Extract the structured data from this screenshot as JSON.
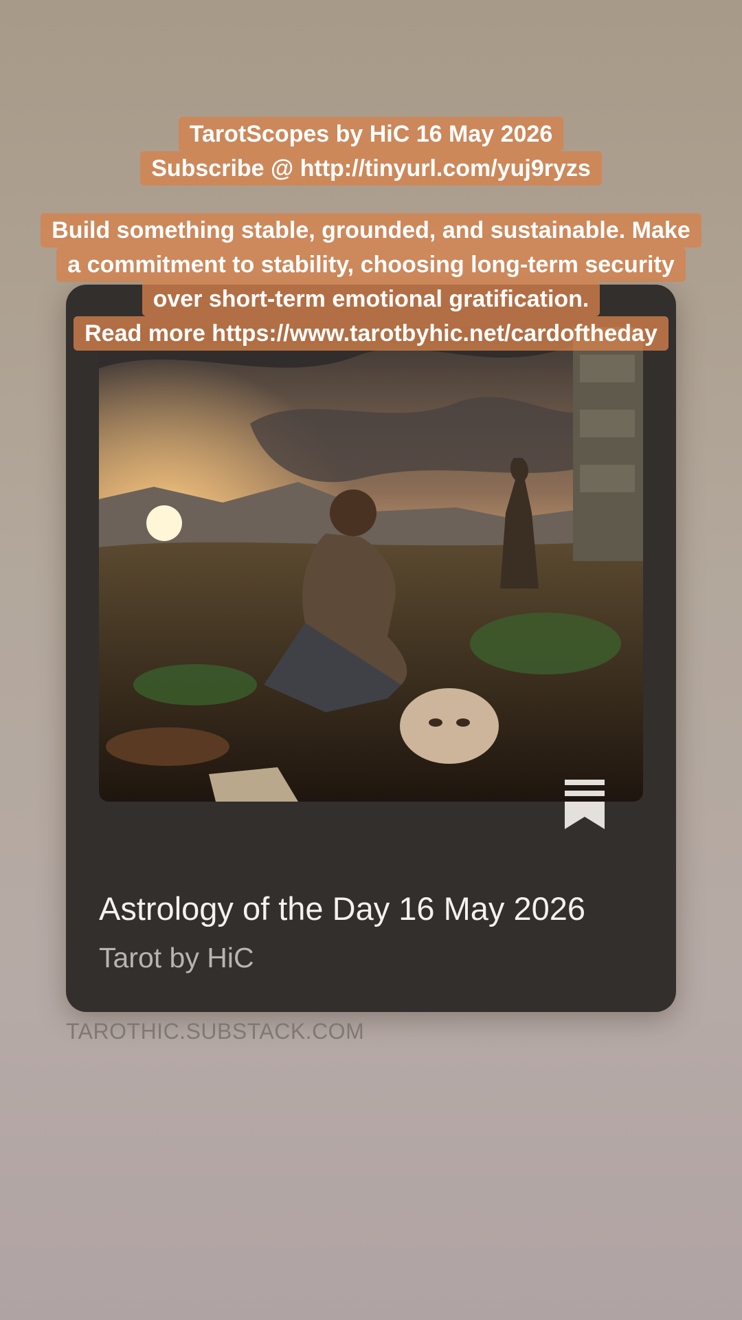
{
  "story_caption": {
    "header_lines": [
      "TarotScopes by HiC 16 May 2026",
      "Subscribe @ http://tinyurl.com/yuj9ryzs"
    ],
    "body_lines": [
      "Build something stable, grounded, and sustainable. Make",
      "a commitment to stability, choosing long-term security",
      "over short-term emotional gratification.",
      "Read more https://www.tarotbyhic.net/cardoftheday"
    ],
    "highlight_color": "#d6824b"
  },
  "link_card": {
    "title": "Astrology of the Day 16 May 2026",
    "author": "Tarot by HiC",
    "image_icon": "tarot-illustration",
    "bookmark_icon": "bookmark-icon"
  },
  "domain_label": "TAROTHIC.SUBSTACK.COM"
}
